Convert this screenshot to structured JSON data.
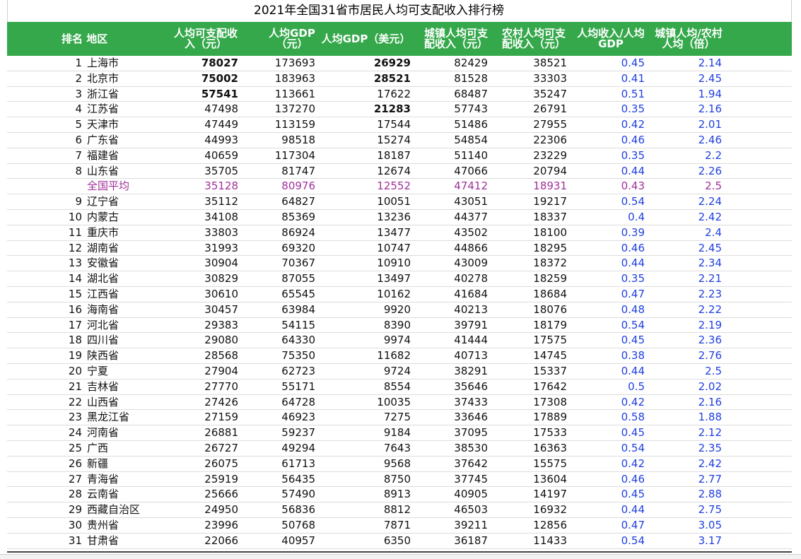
{
  "title": "2021年全国31省市居民人均可支配收入排行榜",
  "headers": {
    "rank_region": "排名 地区",
    "income_line1": "人均可支配收",
    "income_line2": "入（元）",
    "gdp_line1": "人均GDP",
    "gdp_line2": "（元）",
    "gdp_usd": "人均GDP（美元）",
    "urban_line1": "城镇人均可支",
    "urban_line2": "配收入（元）",
    "rural_line1": "农村人均可支",
    "rural_line2": "配收入（元）",
    "ratio1_line1": "人均收入/人均",
    "ratio1_line2": "GDP",
    "ratio2_line1": "城镇人均/农村",
    "ratio2_line2": "人均（倍）"
  },
  "colors": {
    "header_bg": "#34a84a",
    "ratio_text": "#1f3fe0",
    "average_row": "#a0309a"
  },
  "rows": [
    {
      "rank": "1",
      "region": "上海市",
      "income": "78027",
      "gdp": "173693",
      "gdp_usd": "26929",
      "urban": "82429",
      "rural": "38521",
      "ratio1": "0.45",
      "ratio2": "2.14",
      "bold_income": true,
      "bold_usd": true
    },
    {
      "rank": "2",
      "region": "北京市",
      "income": "75002",
      "gdp": "183963",
      "gdp_usd": "28521",
      "urban": "81528",
      "rural": "33303",
      "ratio1": "0.41",
      "ratio2": "2.45",
      "bold_income": true,
      "bold_usd": true
    },
    {
      "rank": "3",
      "region": "浙江省",
      "income": "57541",
      "gdp": "113661",
      "gdp_usd": "17622",
      "urban": "68487",
      "rural": "35247",
      "ratio1": "0.51",
      "ratio2": "1.94",
      "bold_income": true,
      "bold_usd": false
    },
    {
      "rank": "4",
      "region": "江苏省",
      "income": "47498",
      "gdp": "137270",
      "gdp_usd": "21283",
      "urban": "57743",
      "rural": "26791",
      "ratio1": "0.35",
      "ratio2": "2.16",
      "bold_income": false,
      "bold_usd": true
    },
    {
      "rank": "5",
      "region": "天津市",
      "income": "47449",
      "gdp": "113159",
      "gdp_usd": "17544",
      "urban": "51486",
      "rural": "27955",
      "ratio1": "0.42",
      "ratio2": "2.01"
    },
    {
      "rank": "6",
      "region": "广东省",
      "income": "44993",
      "gdp": "98518",
      "gdp_usd": "15274",
      "urban": "54854",
      "rural": "22306",
      "ratio1": "0.46",
      "ratio2": "2.46"
    },
    {
      "rank": "7",
      "region": "福建省",
      "income": "40659",
      "gdp": "117304",
      "gdp_usd": "18187",
      "urban": "51140",
      "rural": "23229",
      "ratio1": "0.35",
      "ratio2": "2.2"
    },
    {
      "rank": "8",
      "region": "山东省",
      "income": "35705",
      "gdp": "81747",
      "gdp_usd": "12674",
      "urban": "47066",
      "rural": "20794",
      "ratio1": "0.44",
      "ratio2": "2.26"
    },
    {
      "rank": "",
      "region": "全国平均",
      "income": "35128",
      "gdp": "80976",
      "gdp_usd": "12552",
      "urban": "47412",
      "rural": "18931",
      "ratio1": "0.43",
      "ratio2": "2.5",
      "average": true
    },
    {
      "rank": "9",
      "region": "辽宁省",
      "income": "35112",
      "gdp": "64827",
      "gdp_usd": "10051",
      "urban": "43051",
      "rural": "19217",
      "ratio1": "0.54",
      "ratio2": "2.24"
    },
    {
      "rank": "10",
      "region": "内蒙古",
      "income": "34108",
      "gdp": "85369",
      "gdp_usd": "13236",
      "urban": "44377",
      "rural": "18337",
      "ratio1": "0.4",
      "ratio2": "2.42"
    },
    {
      "rank": "11",
      "region": "重庆市",
      "income": "33803",
      "gdp": "86924",
      "gdp_usd": "13477",
      "urban": "43502",
      "rural": "18100",
      "ratio1": "0.39",
      "ratio2": "2.4"
    },
    {
      "rank": "12",
      "region": "湖南省",
      "income": "31993",
      "gdp": "69320",
      "gdp_usd": "10747",
      "urban": "44866",
      "rural": "18295",
      "ratio1": "0.46",
      "ratio2": "2.45"
    },
    {
      "rank": "13",
      "region": "安徽省",
      "income": "30904",
      "gdp": "70367",
      "gdp_usd": "10910",
      "urban": "43009",
      "rural": "18372",
      "ratio1": "0.44",
      "ratio2": "2.34"
    },
    {
      "rank": "14",
      "region": "湖北省",
      "income": "30829",
      "gdp": "87055",
      "gdp_usd": "13497",
      "urban": "40278",
      "rural": "18259",
      "ratio1": "0.35",
      "ratio2": "2.21"
    },
    {
      "rank": "15",
      "region": "江西省",
      "income": "30610",
      "gdp": "65545",
      "gdp_usd": "10162",
      "urban": "41684",
      "rural": "18684",
      "ratio1": "0.47",
      "ratio2": "2.23"
    },
    {
      "rank": "16",
      "region": "海南省",
      "income": "30457",
      "gdp": "63984",
      "gdp_usd": "9920",
      "urban": "40213",
      "rural": "18076",
      "ratio1": "0.48",
      "ratio2": "2.22"
    },
    {
      "rank": "17",
      "region": "河北省",
      "income": "29383",
      "gdp": "54115",
      "gdp_usd": "8390",
      "urban": "39791",
      "rural": "18179",
      "ratio1": "0.54",
      "ratio2": "2.19"
    },
    {
      "rank": "18",
      "region": "四川省",
      "income": "29080",
      "gdp": "64330",
      "gdp_usd": "9974",
      "urban": "41444",
      "rural": "17575",
      "ratio1": "0.45",
      "ratio2": "2.36"
    },
    {
      "rank": "19",
      "region": "陕西省",
      "income": "28568",
      "gdp": "75350",
      "gdp_usd": "11682",
      "urban": "40713",
      "rural": "14745",
      "ratio1": "0.38",
      "ratio2": "2.76"
    },
    {
      "rank": "20",
      "region": "宁夏",
      "income": "27904",
      "gdp": "62723",
      "gdp_usd": "9724",
      "urban": "38291",
      "rural": "15337",
      "ratio1": "0.44",
      "ratio2": "2.5"
    },
    {
      "rank": "21",
      "region": "吉林省",
      "income": "27770",
      "gdp": "55171",
      "gdp_usd": "8554",
      "urban": "35646",
      "rural": "17642",
      "ratio1": "0.5",
      "ratio2": "2.02"
    },
    {
      "rank": "22",
      "region": "山西省",
      "income": "27426",
      "gdp": "64728",
      "gdp_usd": "10035",
      "urban": "37433",
      "rural": "17308",
      "ratio1": "0.42",
      "ratio2": "2.16"
    },
    {
      "rank": "23",
      "region": "黑龙江省",
      "income": "27159",
      "gdp": "46923",
      "gdp_usd": "7275",
      "urban": "33646",
      "rural": "17889",
      "ratio1": "0.58",
      "ratio2": "1.88"
    },
    {
      "rank": "24",
      "region": "河南省",
      "income": "26881",
      "gdp": "59237",
      "gdp_usd": "9184",
      "urban": "37095",
      "rural": "17533",
      "ratio1": "0.45",
      "ratio2": "2.12"
    },
    {
      "rank": "25",
      "region": "广西",
      "income": "26727",
      "gdp": "49294",
      "gdp_usd": "7643",
      "urban": "38530",
      "rural": "16363",
      "ratio1": "0.54",
      "ratio2": "2.35"
    },
    {
      "rank": "26",
      "region": "新疆",
      "income": "26075",
      "gdp": "61713",
      "gdp_usd": "9568",
      "urban": "37642",
      "rural": "15575",
      "ratio1": "0.42",
      "ratio2": "2.42"
    },
    {
      "rank": "27",
      "region": "青海省",
      "income": "25919",
      "gdp": "56435",
      "gdp_usd": "8750",
      "urban": "37745",
      "rural": "13604",
      "ratio1": "0.46",
      "ratio2": "2.77"
    },
    {
      "rank": "28",
      "region": "云南省",
      "income": "25666",
      "gdp": "57490",
      "gdp_usd": "8913",
      "urban": "40905",
      "rural": "14197",
      "ratio1": "0.45",
      "ratio2": "2.88"
    },
    {
      "rank": "29",
      "region": "西藏自治区",
      "income": "24950",
      "gdp": "56836",
      "gdp_usd": "8812",
      "urban": "46503",
      "rural": "16932",
      "ratio1": "0.44",
      "ratio2": "2.75"
    },
    {
      "rank": "30",
      "region": "贵州省",
      "income": "23996",
      "gdp": "50768",
      "gdp_usd": "7871",
      "urban": "39211",
      "rural": "12856",
      "ratio1": "0.47",
      "ratio2": "3.05"
    },
    {
      "rank": "31",
      "region": "甘肃省",
      "income": "22066",
      "gdp": "40957",
      "gdp_usd": "6350",
      "urban": "36187",
      "rural": "11433",
      "ratio1": "0.54",
      "ratio2": "3.17"
    }
  ]
}
